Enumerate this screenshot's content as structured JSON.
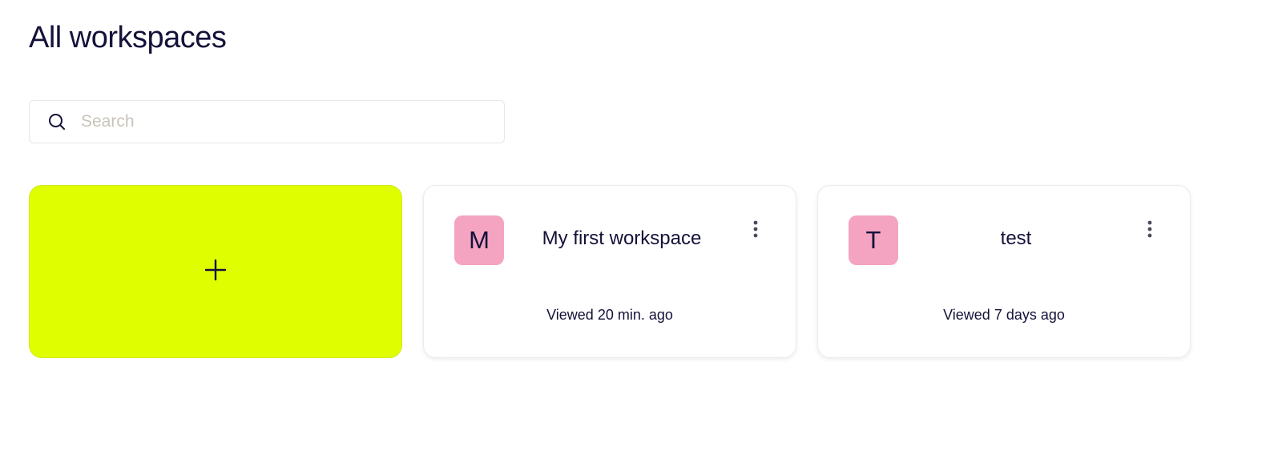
{
  "page": {
    "title": "All workspaces"
  },
  "search": {
    "placeholder": "Search",
    "value": ""
  },
  "create_card": {
    "icon": "plus-icon",
    "color": "#dfff00"
  },
  "workspaces": [
    {
      "initial": "M",
      "name": "My first workspace",
      "viewed": "Viewed 20 min. ago",
      "avatar_color": "#f4a3c1"
    },
    {
      "initial": "T",
      "name": "test",
      "viewed": "Viewed 7 days ago",
      "avatar_color": "#f4a3c1"
    }
  ],
  "icons": {
    "search": "search-icon",
    "more": "more-vertical-icon"
  },
  "colors": {
    "text": "#14123a",
    "accent": "#dfff00",
    "avatar": "#f4a3c1"
  }
}
